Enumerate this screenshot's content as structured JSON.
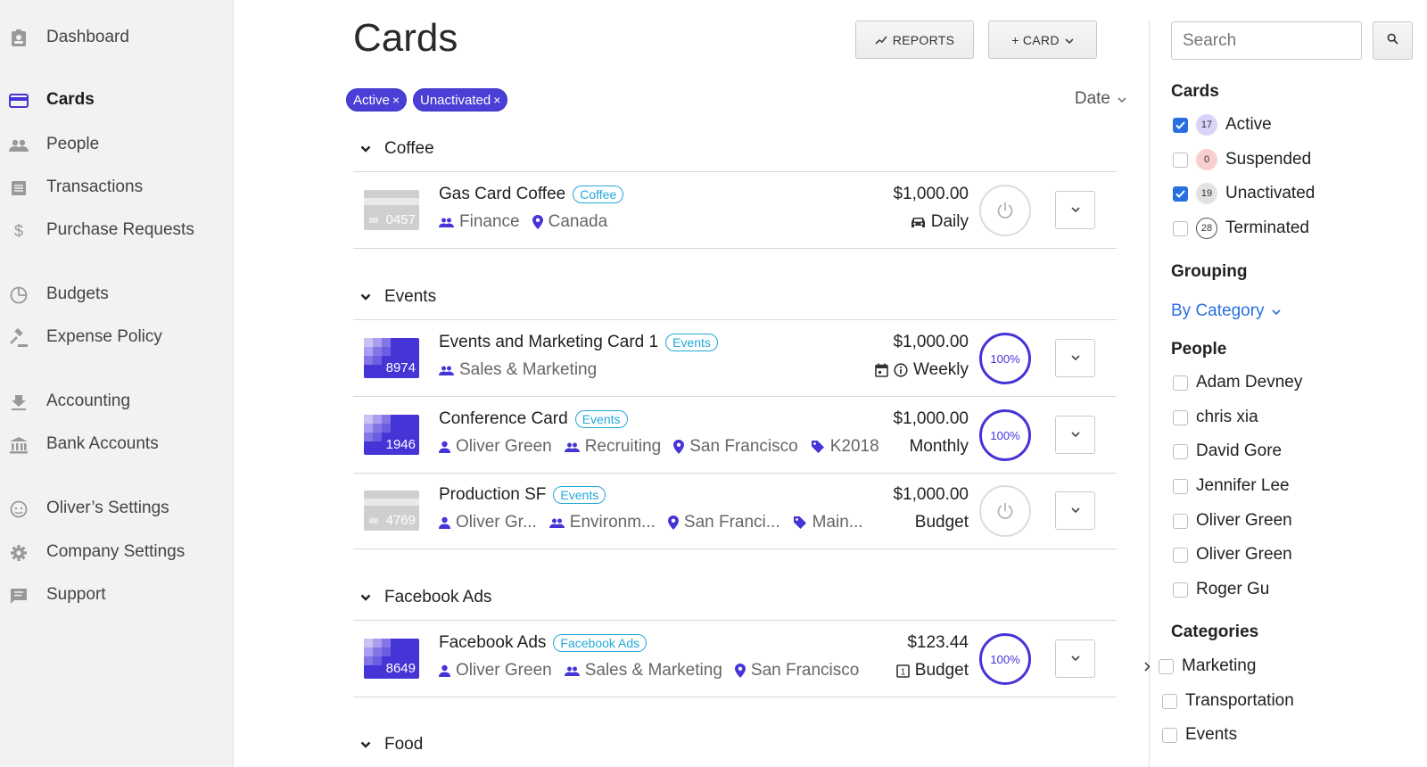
{
  "sidebar": {
    "items": [
      {
        "label": "Dashboard",
        "icon": "id-badge-icon"
      },
      {
        "label": "Cards",
        "icon": "credit-card-icon",
        "active": true
      },
      {
        "label": "People",
        "icon": "people-icon"
      },
      {
        "label": "Transactions",
        "icon": "list-icon"
      },
      {
        "label": "Purchase Requests",
        "icon": "dollar-icon"
      },
      {
        "label": "Budgets",
        "icon": "pie-chart-icon"
      },
      {
        "label": "Expense Policy",
        "icon": "gavel-icon"
      },
      {
        "label": "Accounting",
        "icon": "download-icon"
      },
      {
        "label": "Bank Accounts",
        "icon": "bank-icon"
      },
      {
        "label": "Oliver’s Settings",
        "icon": "face-icon"
      },
      {
        "label": "Company Settings",
        "icon": "gear-icon"
      },
      {
        "label": "Support",
        "icon": "chat-icon"
      }
    ]
  },
  "main": {
    "title": "Cards",
    "reports_label": "REPORTS",
    "add_card_label": "+ CARD",
    "chips": [
      "Active",
      "Unactivated"
    ],
    "chip_close": "×",
    "sort_label": "Date",
    "groups": [
      {
        "name": "Coffee",
        "cards": [
          {
            "name": "Gas Card Coffee",
            "tag": "Coffee",
            "last4": "0457",
            "status": "off",
            "meta": [
              {
                "icon": "group-icon",
                "text": "Finance"
              },
              {
                "icon": "location-pin-icon",
                "text": "Canada"
              }
            ],
            "amount": "$1,000.00",
            "period_icons": [
              "car-icon"
            ],
            "period": "Daily"
          }
        ]
      },
      {
        "name": "Events",
        "cards": [
          {
            "name": "Events and Marketing Card 1",
            "tag": "Events",
            "last4": "8974",
            "status": "on",
            "percent": "100%",
            "meta": [
              {
                "icon": "group-icon",
                "text": "Sales & Marketing"
              }
            ],
            "amount": "$1,000.00",
            "period_icons": [
              "calendar-icon",
              "info-icon"
            ],
            "period": "Weekly"
          },
          {
            "name": "Conference Card",
            "tag": "Events",
            "last4": "1946",
            "status": "on",
            "percent": "100%",
            "meta": [
              {
                "icon": "person-icon",
                "text": "Oliver Green"
              },
              {
                "icon": "group-icon",
                "text": "Recruiting"
              },
              {
                "icon": "location-pin-icon",
                "text": "San Francisco"
              },
              {
                "icon": "tag-icon",
                "text": "K2018"
              }
            ],
            "amount": "$1,000.00",
            "period_icons": [],
            "period": "Monthly"
          },
          {
            "name": "Production SF",
            "tag": "Events",
            "last4": "4769",
            "status": "off",
            "meta": [
              {
                "icon": "person-icon",
                "text": "Oliver Gr..."
              },
              {
                "icon": "group-icon",
                "text": "Environm..."
              },
              {
                "icon": "location-pin-icon",
                "text": "San Franci..."
              },
              {
                "icon": "tag-icon",
                "text": "Main..."
              }
            ],
            "amount": "$1,000.00",
            "period_icons": [],
            "period": "Budget"
          }
        ]
      },
      {
        "name": "Facebook Ads",
        "cards": [
          {
            "name": "Facebook Ads",
            "tag": "Facebook Ads",
            "last4": "8649",
            "status": "on",
            "percent": "100%",
            "meta": [
              {
                "icon": "person-icon",
                "text": "Oliver Green"
              },
              {
                "icon": "group-icon",
                "text": "Sales & Marketing"
              },
              {
                "icon": "location-pin-icon",
                "text": "San Francisco"
              }
            ],
            "amount": "$123.44",
            "period_icons": [
              "budget-icon"
            ],
            "period": "Budget"
          }
        ]
      },
      {
        "name": "Food",
        "cards": []
      }
    ]
  },
  "right_panel": {
    "search": {
      "placeholder": "Search",
      "value": ""
    },
    "cards_title": "Cards",
    "card_filters": [
      {
        "label": "Active",
        "count": "17",
        "checked": true,
        "color": "#d9d3f7"
      },
      {
        "label": "Suspended",
        "count": "0",
        "checked": false,
        "color": "#f8cfcf"
      },
      {
        "label": "Unactivated",
        "count": "19",
        "checked": true,
        "color": "#e2e2e2"
      },
      {
        "label": "Terminated",
        "count": "28",
        "checked": false,
        "color": "#ffffff"
      }
    ],
    "grouping_title": "Grouping",
    "grouping_value": "By Category",
    "people_title": "People",
    "people": [
      "Adam Devney",
      "chris xia",
      "David Gore",
      "Jennifer Lee",
      "Oliver Green",
      "Oliver Green",
      "Roger Gu"
    ],
    "categories_title": "Categories",
    "categories": [
      {
        "label": "Marketing",
        "expandable": true
      },
      {
        "label": "Transportation",
        "expandable": false
      },
      {
        "label": "Events",
        "expandable": false
      }
    ]
  },
  "colors": {
    "accent": "#4534d6",
    "link": "#2a6fe0",
    "tag": "#23a8d8"
  }
}
